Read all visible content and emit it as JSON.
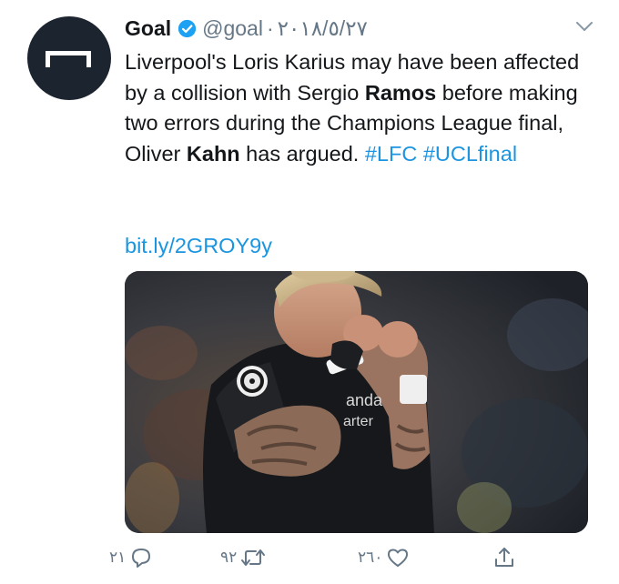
{
  "tweet": {
    "author_name": "Goal",
    "handle": "@goal",
    "separator": "·",
    "date": "٢٠١٨/٥/٢٧",
    "text_parts": [
      {
        "t": "Liverpool's Loris Karius may have been affected by a collision with Sergio "
      },
      {
        "t": "Ramos"
      },
      {
        "t": " before making two errors during the Champions League final, Oliver "
      },
      {
        "t": "Kahn"
      },
      {
        "t": " has argued. "
      },
      {
        "t": "#LFC"
      },
      {
        "t": " "
      },
      {
        "t": "#UCLfinal"
      }
    ],
    "link": "bit.ly/2GROY9y",
    "media_text": {
      "sponsor_line1": "anda",
      "sponsor_line2": "arter"
    }
  },
  "actions": {
    "reply_count": "٢١",
    "retweet_count": "٩٢",
    "like_count": "٢٦٠"
  },
  "icons": {
    "avatar": "goal-logo-icon",
    "verified": "verified-badge-icon",
    "caret": "chevron-down-icon",
    "reply": "reply-icon",
    "retweet": "retweet-icon",
    "like": "heart-icon",
    "share": "share-icon"
  },
  "colors": {
    "link": "#1b95e0",
    "muted": "#657786",
    "verified": "#1da1f2",
    "avatar_bg": "#1c2430"
  }
}
